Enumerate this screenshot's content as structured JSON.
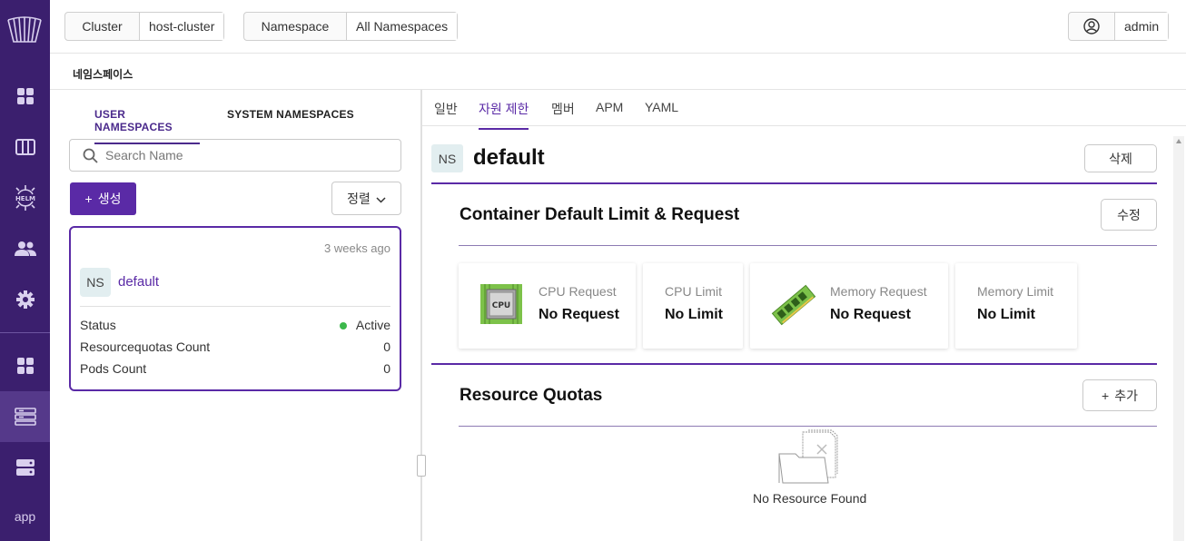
{
  "topbar": {
    "cluster_label": "Cluster",
    "cluster_value": "host-cluster",
    "namespace_label": "Namespace",
    "namespace_value": "All Namespaces",
    "user_name": "admin"
  },
  "sidebar": {
    "items": [
      {
        "icon": "dashboard-icon"
      },
      {
        "icon": "columns-icon"
      },
      {
        "icon": "helm-icon",
        "label": "HELM"
      },
      {
        "icon": "users-icon"
      },
      {
        "icon": "gear-icon"
      },
      {
        "icon": "apps-grid-icon"
      },
      {
        "icon": "namespace-list-icon",
        "active": true
      },
      {
        "icon": "server-icon"
      }
    ],
    "app_label": "app"
  },
  "page": {
    "title": "네임스페이스"
  },
  "left": {
    "tabs": [
      "USER NAMESPACES",
      "SYSTEM NAMESPACES"
    ],
    "search_placeholder": "Search Name",
    "create_label": "생성",
    "sort_label": "정렬",
    "card": {
      "time": "3 weeks ago",
      "badge": "NS",
      "name": "default",
      "rows": [
        {
          "key": "Status",
          "value": "Active"
        },
        {
          "key": "Resourcequotas Count",
          "value": "0"
        },
        {
          "key": "Pods Count",
          "value": "0"
        }
      ]
    }
  },
  "right": {
    "tabs": [
      "일반",
      "자원 제한",
      "멤버",
      "APM",
      "YAML"
    ],
    "active_tab": "자원 제한",
    "badge": "NS",
    "name": "default",
    "delete_label": "삭제",
    "container_section": {
      "title": "Container Default Limit & Request",
      "edit_label": "수정",
      "cards": [
        {
          "label": "CPU Request",
          "value": "No Request",
          "icon": "cpu-icon",
          "icon_text": "CPU"
        },
        {
          "label": "CPU Limit",
          "value": "No Limit"
        },
        {
          "label": "Memory Request",
          "value": "No Request",
          "icon": "memory-icon"
        },
        {
          "label": "Memory Limit",
          "value": "No Limit"
        }
      ]
    },
    "quota_section": {
      "title": "Resource Quotas",
      "add_label": "추가",
      "empty_text": "No Resource Found"
    }
  },
  "colors": {
    "rail_bg": "#3b1f6e",
    "accent": "#5a2aa6",
    "status_active": "#3cb84b"
  }
}
